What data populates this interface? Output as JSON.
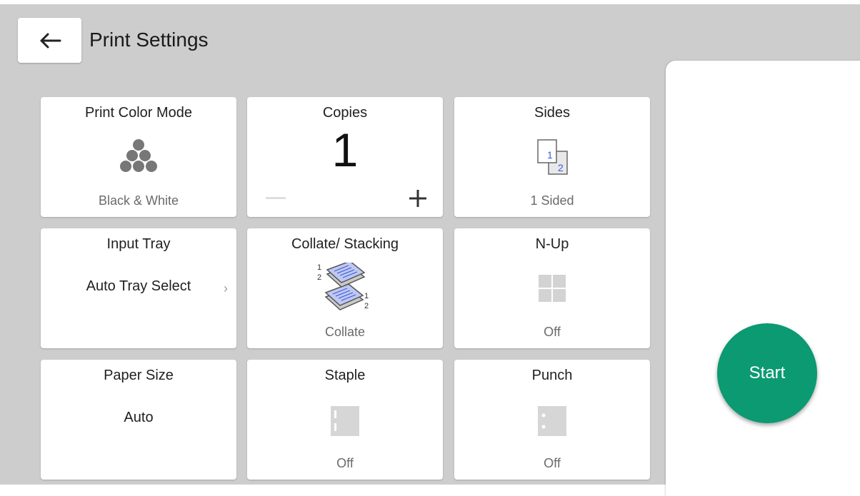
{
  "header": {
    "title": "Print Settings"
  },
  "start": {
    "label": "Start"
  },
  "tiles": {
    "print_color_mode": {
      "title": "Print Color Mode",
      "value": "Black & White",
      "icon": "color-dots-icon"
    },
    "copies": {
      "title": "Copies",
      "value": "1"
    },
    "sides": {
      "title": "Sides",
      "value": "1 Sided",
      "icon_digits": [
        "1",
        "2"
      ]
    },
    "input_tray": {
      "title": "Input Tray",
      "value": "Auto Tray Select",
      "chevron": "›"
    },
    "collate": {
      "title": "Collate/ Stacking",
      "value": "Collate",
      "icon_digits": [
        "1",
        "2",
        "1",
        "2"
      ]
    },
    "nup": {
      "title": "N-Up",
      "value": "Off",
      "icon": "grid-four-icon"
    },
    "paper_size": {
      "title": "Paper Size",
      "value": "Auto"
    },
    "staple": {
      "title": "Staple",
      "value": "Off",
      "icon": "staple-icon"
    },
    "punch": {
      "title": "Punch",
      "value": "Off",
      "icon": "punch-icon"
    }
  },
  "colors": {
    "accent": "#0b9a72",
    "background": "#cdcdcd",
    "icon_blue": "#3b5bdb"
  }
}
